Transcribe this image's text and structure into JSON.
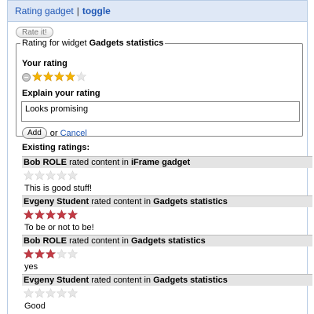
{
  "header": {
    "title": "Rating gadget",
    "separator": "|",
    "toggle": "toggle"
  },
  "rate_button": "Rate it!",
  "form": {
    "legend_prefix": "Rating for widget ",
    "legend_widget": "Gadgets statistics",
    "your_rating_label": "Your rating",
    "your_rating_value": 4,
    "your_rating_max": 5,
    "explain_label": "Explain your rating",
    "explain_value": "Looks promising",
    "add_label": "Add",
    "or_text": "or",
    "cancel_label": "Cancel"
  },
  "existing": {
    "title": "Existing ratings:",
    "connector": "rated content in",
    "ratings": [
      {
        "user": "Bob ROLE",
        "content": "iFrame gadget",
        "stars": 0,
        "comment": "This is good stuff!"
      },
      {
        "user": "Evgeny Student",
        "content": "Gadgets statistics",
        "stars": 5,
        "comment": "To be or not to be!"
      },
      {
        "user": "Bob ROLE",
        "content": "Gadgets statistics",
        "stars": 3,
        "comment": "yes"
      },
      {
        "user": "Evgeny Student",
        "content": "Gadgets statistics",
        "stars": 0,
        "comment": "Good"
      }
    ]
  },
  "colors": {
    "header_bg": "#dfe8f6",
    "link": "#1f57b5",
    "star_gold": "#f4b400",
    "star_red": "#c33a44",
    "star_empty": "#e7e7e7"
  }
}
